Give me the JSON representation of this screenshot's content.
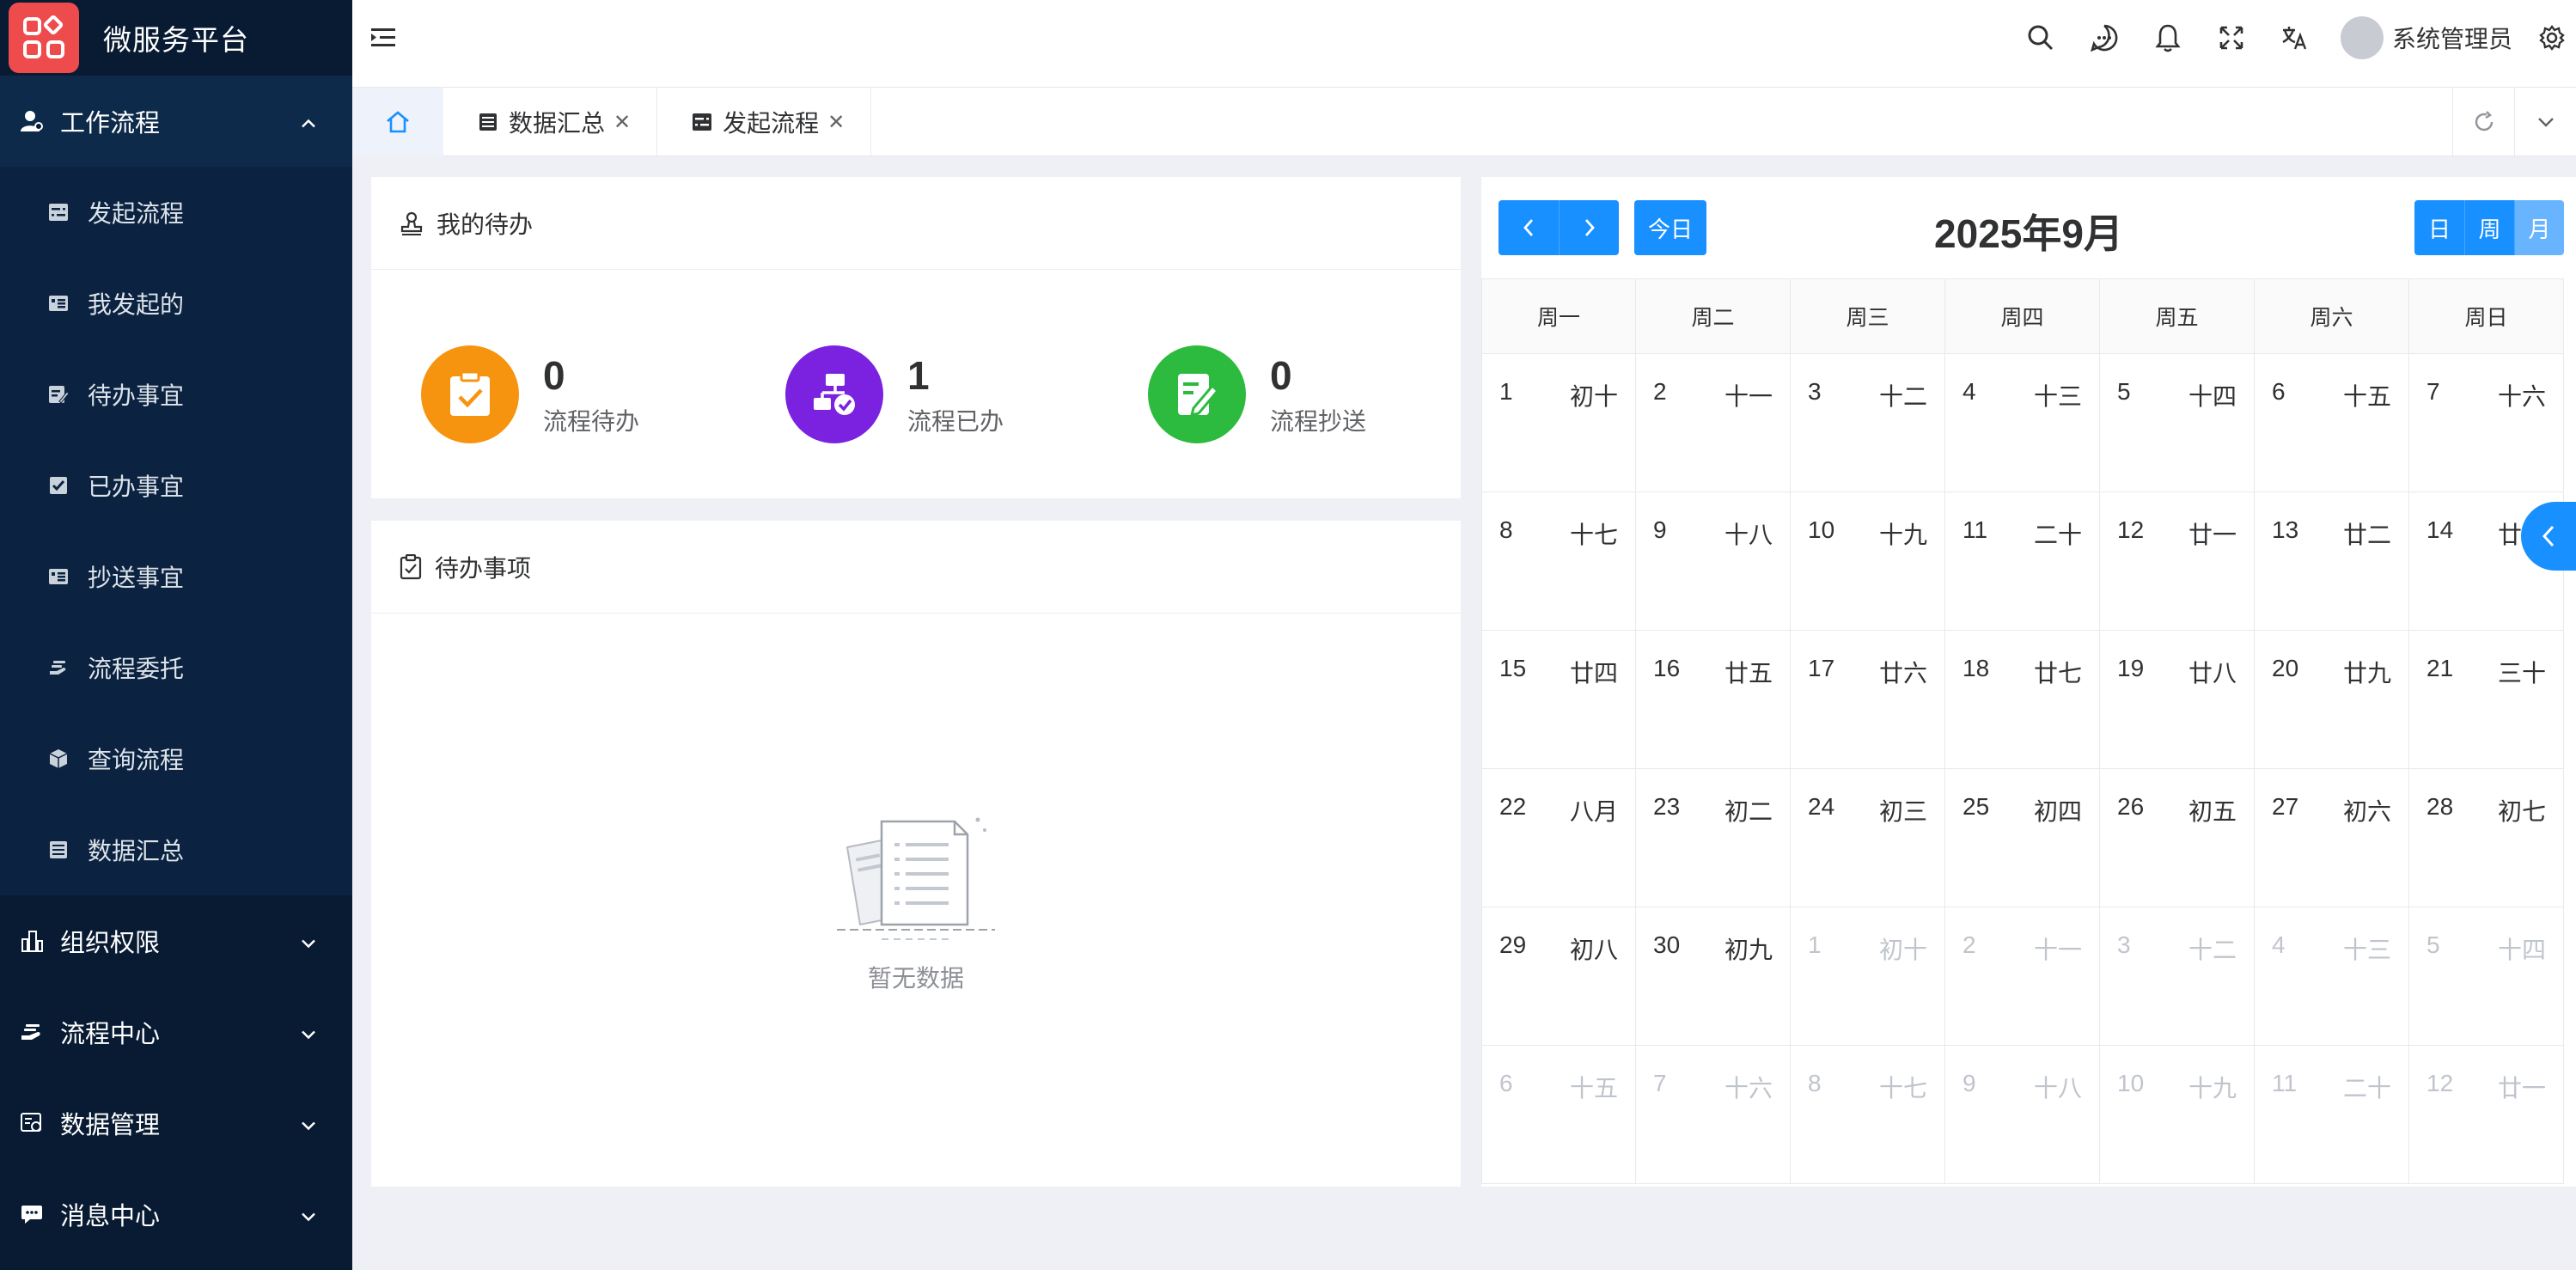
{
  "app": {
    "title": "微服务平台"
  },
  "sidebar": {
    "open_group": {
      "label": "工作流程",
      "items": [
        {
          "label": "发起流程",
          "icon": "form-icon"
        },
        {
          "label": "我发起的",
          "icon": "list-card-icon"
        },
        {
          "label": "待办事宜",
          "icon": "edit-doc-icon"
        },
        {
          "label": "已办事宜",
          "icon": "checked-doc-icon"
        },
        {
          "label": "抄送事宜",
          "icon": "list-card-icon"
        },
        {
          "label": "流程委托",
          "icon": "hand-icon"
        },
        {
          "label": "查询流程",
          "icon": "box-icon"
        },
        {
          "label": "数据汇总",
          "icon": "table-icon"
        }
      ]
    },
    "groups": [
      {
        "label": "组织权限",
        "icon": "org-icon"
      },
      {
        "label": "流程中心",
        "icon": "hand-icon"
      },
      {
        "label": "数据管理",
        "icon": "data-icon"
      },
      {
        "label": "消息中心",
        "icon": "message-icon"
      }
    ]
  },
  "header": {
    "user_name": "系统管理员",
    "icons": [
      "search-icon",
      "chat-icon",
      "bell-icon",
      "fullscreen-icon",
      "translate-icon",
      "gear-icon"
    ]
  },
  "tabs": [
    {
      "label": "数据汇总",
      "icon": "table-icon"
    },
    {
      "label": "发起流程",
      "icon": "form-icon"
    }
  ],
  "todo_card": {
    "title": "我的待办",
    "stats": [
      {
        "value": "0",
        "label": "流程待办",
        "color": "#f7940f",
        "icon": "clipboard-check-icon"
      },
      {
        "value": "1",
        "label": "流程已办",
        "color": "#7a22e0",
        "icon": "flow-check-icon"
      },
      {
        "value": "0",
        "label": "流程抄送",
        "color": "#2dbb3f",
        "icon": "edit-note-icon"
      }
    ]
  },
  "pending_card": {
    "title": "待办事项",
    "empty_text": "暂无数据"
  },
  "calendar": {
    "title": "2025年9月",
    "today_label": "今日",
    "views": [
      "日",
      "周",
      "月"
    ],
    "active_view": "月",
    "weekdays": [
      "周一",
      "周二",
      "周三",
      "周四",
      "周五",
      "周六",
      "周日"
    ],
    "weeks": [
      [
        {
          "d": "1",
          "l": "初十"
        },
        {
          "d": "2",
          "l": "十一"
        },
        {
          "d": "3",
          "l": "十二"
        },
        {
          "d": "4",
          "l": "十三"
        },
        {
          "d": "5",
          "l": "十四"
        },
        {
          "d": "6",
          "l": "十五"
        },
        {
          "d": "7",
          "l": "十六"
        }
      ],
      [
        {
          "d": "8",
          "l": "十七"
        },
        {
          "d": "9",
          "l": "十八"
        },
        {
          "d": "10",
          "l": "十九"
        },
        {
          "d": "11",
          "l": "二十"
        },
        {
          "d": "12",
          "l": "廿一"
        },
        {
          "d": "13",
          "l": "廿二"
        },
        {
          "d": "14",
          "l": "廿三"
        }
      ],
      [
        {
          "d": "15",
          "l": "廿四"
        },
        {
          "d": "16",
          "l": "廿五"
        },
        {
          "d": "17",
          "l": "廿六"
        },
        {
          "d": "18",
          "l": "廿七"
        },
        {
          "d": "19",
          "l": "廿八"
        },
        {
          "d": "20",
          "l": "廿九"
        },
        {
          "d": "21",
          "l": "三十"
        }
      ],
      [
        {
          "d": "22",
          "l": "八月"
        },
        {
          "d": "23",
          "l": "初二"
        },
        {
          "d": "24",
          "l": "初三"
        },
        {
          "d": "25",
          "l": "初四"
        },
        {
          "d": "26",
          "l": "初五"
        },
        {
          "d": "27",
          "l": "初六"
        },
        {
          "d": "28",
          "l": "初七"
        }
      ],
      [
        {
          "d": "29",
          "l": "初八"
        },
        {
          "d": "30",
          "l": "初九"
        },
        {
          "d": "1",
          "l": "初十",
          "other": true
        },
        {
          "d": "2",
          "l": "十一",
          "other": true
        },
        {
          "d": "3",
          "l": "十二",
          "other": true
        },
        {
          "d": "4",
          "l": "十三",
          "other": true
        },
        {
          "d": "5",
          "l": "十四",
          "other": true
        }
      ],
      [
        {
          "d": "6",
          "l": "十五",
          "other": true
        },
        {
          "d": "7",
          "l": "十六",
          "other": true
        },
        {
          "d": "8",
          "l": "十七",
          "other": true
        },
        {
          "d": "9",
          "l": "十八",
          "other": true
        },
        {
          "d": "10",
          "l": "十九",
          "other": true
        },
        {
          "d": "11",
          "l": "二十",
          "other": true
        },
        {
          "d": "12",
          "l": "廿一",
          "other": true
        }
      ]
    ]
  },
  "colors": {
    "sidebar_bg": "#081b33",
    "accent": "#1890ff",
    "logo": "#ee4c4c"
  }
}
